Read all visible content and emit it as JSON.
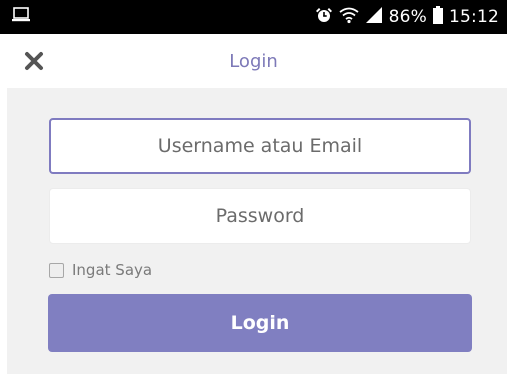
{
  "status_bar": {
    "battery": "86%",
    "time": "15:12",
    "icons": [
      "screen-icon",
      "alarm-icon",
      "wifi-icon",
      "signal-icon",
      "battery-icon"
    ]
  },
  "app_bar": {
    "title": "Login",
    "close_icon": "close-icon"
  },
  "form": {
    "username_placeholder": "Username atau Email",
    "password_placeholder": "Password",
    "remember_label": "Ingat Saya",
    "remember_checked": false,
    "login_label": "Login"
  },
  "colors": {
    "accent": "#807fc1",
    "title": "#7d79b8",
    "background": "#f1f1f1",
    "status_bar": "#000000"
  }
}
